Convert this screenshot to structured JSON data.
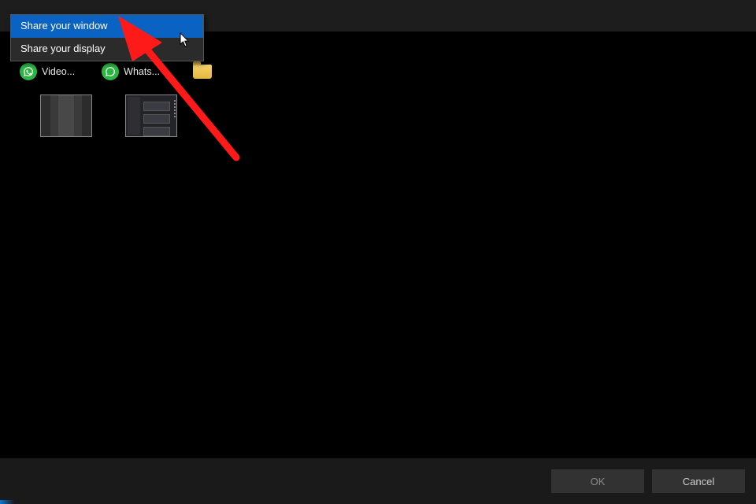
{
  "menu": {
    "items": [
      {
        "label": "Share your window",
        "selected": true
      },
      {
        "label": "Share your display",
        "selected": false
      }
    ]
  },
  "labels": {
    "item0": "Video...",
    "item1": "Whats..."
  },
  "footer": {
    "ok_label": "OK",
    "cancel_label": "Cancel"
  },
  "annotation": {
    "color": "#ff1a1a"
  }
}
